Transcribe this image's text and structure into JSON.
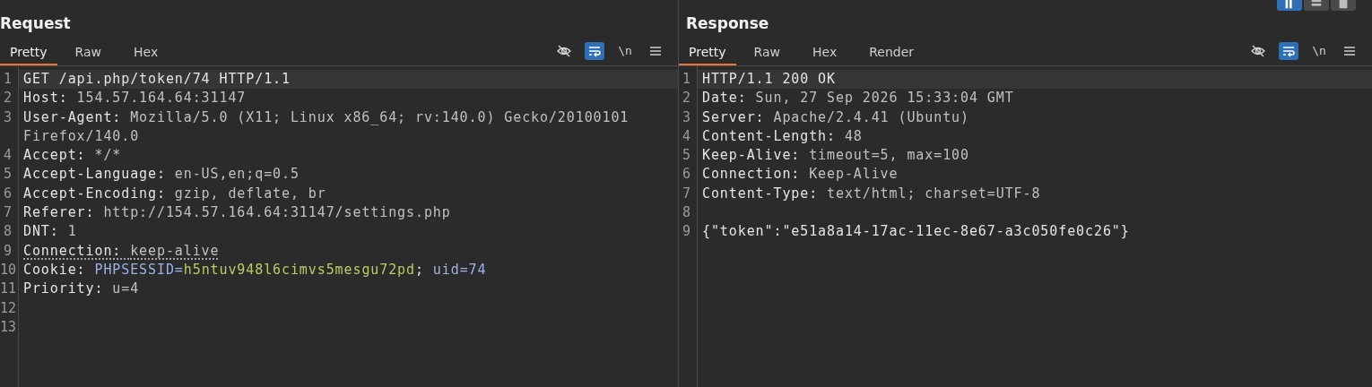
{
  "view_buttons": [
    {
      "kind": "columns",
      "selected": true
    },
    {
      "kind": "rows",
      "selected": false
    },
    {
      "kind": "single",
      "selected": false
    }
  ],
  "panes": [
    {
      "title": "Request",
      "tabs": [
        {
          "label": "Pretty",
          "selected": true
        },
        {
          "label": "Raw",
          "selected": false
        },
        {
          "label": "Hex",
          "selected": false
        }
      ],
      "toolbar": [
        {
          "kind": "hide",
          "on": false
        },
        {
          "kind": "wrap",
          "on": true
        },
        {
          "kind": "newline",
          "label": "\\n",
          "on": false
        },
        {
          "kind": "menu"
        }
      ],
      "lines": [
        {
          "number": "1",
          "current": true,
          "segments": [
            {
              "kind": "name",
              "text": "GET /api.php/token/74 HTTP/1.1"
            }
          ]
        },
        {
          "number": "2",
          "segments": [
            {
              "kind": "name",
              "text": "Host: "
            },
            {
              "kind": "value",
              "text": "154.57.164.64:31147"
            }
          ]
        },
        {
          "number": "3",
          "segments": [
            {
              "kind": "name",
              "text": "User-Agent: "
            },
            {
              "kind": "value",
              "text": "Mozilla/5.0 (X11; Linux x86_64; rv:140.0) Gecko/20100101 Firefox/140.0"
            }
          ]
        },
        {
          "number": "4",
          "segments": [
            {
              "kind": "name",
              "text": "Accept: "
            },
            {
              "kind": "value",
              "text": "*/*"
            }
          ]
        },
        {
          "number": "5",
          "segments": [
            {
              "kind": "name",
              "text": "Accept-Language: "
            },
            {
              "kind": "value",
              "text": "en-US,en;q=0.5"
            }
          ]
        },
        {
          "number": "6",
          "segments": [
            {
              "kind": "name",
              "text": "Accept-Encoding: "
            },
            {
              "kind": "value",
              "text": "gzip, deflate, br"
            }
          ]
        },
        {
          "number": "7",
          "segments": [
            {
              "kind": "name",
              "text": "Referer: "
            },
            {
              "kind": "value",
              "text": "http://154.57.164.64:31147/settings.php"
            }
          ]
        },
        {
          "number": "8",
          "segments": [
            {
              "kind": "name",
              "text": "DNT: "
            },
            {
              "kind": "value",
              "text": "1"
            }
          ]
        },
        {
          "number": "9",
          "underlined": true,
          "segments": [
            {
              "kind": "name",
              "text": "Connection: "
            },
            {
              "kind": "value",
              "text": "keep-alive"
            }
          ]
        },
        {
          "number": "10",
          "segments": [
            {
              "kind": "name",
              "text": "Cookie: "
            },
            {
              "kind": "param",
              "text": "PHPSESSID="
            },
            {
              "kind": "param-value",
              "text": "h5ntuv948l6cimvs5mesgu72pd"
            },
            {
              "kind": "name",
              "text": "; "
            },
            {
              "kind": "param",
              "text": "uid=74"
            }
          ]
        },
        {
          "number": "11",
          "segments": [
            {
              "kind": "name",
              "text": "Priority: "
            },
            {
              "kind": "value",
              "text": "u=4"
            }
          ]
        },
        {
          "number": "12"
        },
        {
          "number": "13"
        }
      ]
    },
    {
      "title": "Response",
      "tabs": [
        {
          "label": "Pretty",
          "selected": true
        },
        {
          "label": "Raw",
          "selected": false
        },
        {
          "label": "Hex",
          "selected": false
        },
        {
          "label": "Render",
          "selected": false
        }
      ],
      "toolbar": [
        {
          "kind": "hide",
          "on": false
        },
        {
          "kind": "wrap",
          "on": true
        },
        {
          "kind": "newline",
          "label": "\\n",
          "on": false
        },
        {
          "kind": "menu"
        }
      ],
      "lines": [
        {
          "number": "1",
          "current": true,
          "segments": [
            {
              "kind": "name",
              "text": "HTTP/1.1 200 OK"
            }
          ]
        },
        {
          "number": "2",
          "segments": [
            {
              "kind": "name",
              "text": "Date: "
            },
            {
              "kind": "value",
              "text": "Sun, 27 Sep 2026 15:33:04 GMT"
            }
          ]
        },
        {
          "number": "3",
          "segments": [
            {
              "kind": "name",
              "text": "Server: "
            },
            {
              "kind": "value",
              "text": "Apache/2.4.41 (Ubuntu)"
            }
          ]
        },
        {
          "number": "4",
          "segments": [
            {
              "kind": "name",
              "text": "Content-Length: "
            },
            {
              "kind": "value",
              "text": "48"
            }
          ]
        },
        {
          "number": "5",
          "segments": [
            {
              "kind": "name",
              "text": "Keep-Alive: "
            },
            {
              "kind": "value",
              "text": "timeout=5, max=100"
            }
          ]
        },
        {
          "number": "6",
          "segments": [
            {
              "kind": "name",
              "text": "Connection: "
            },
            {
              "kind": "value",
              "text": "Keep-Alive"
            }
          ]
        },
        {
          "number": "7",
          "segments": [
            {
              "kind": "name",
              "text": "Content-Type: "
            },
            {
              "kind": "value",
              "text": "text/html; charset=UTF-8"
            }
          ]
        },
        {
          "number": "8"
        },
        {
          "number": "9",
          "segments": [
            {
              "kind": "name",
              "text": "{\"token\":\"e51a8a14-17ac-11ec-8e67-a3c050fe0c26\"}"
            }
          ]
        }
      ]
    }
  ]
}
